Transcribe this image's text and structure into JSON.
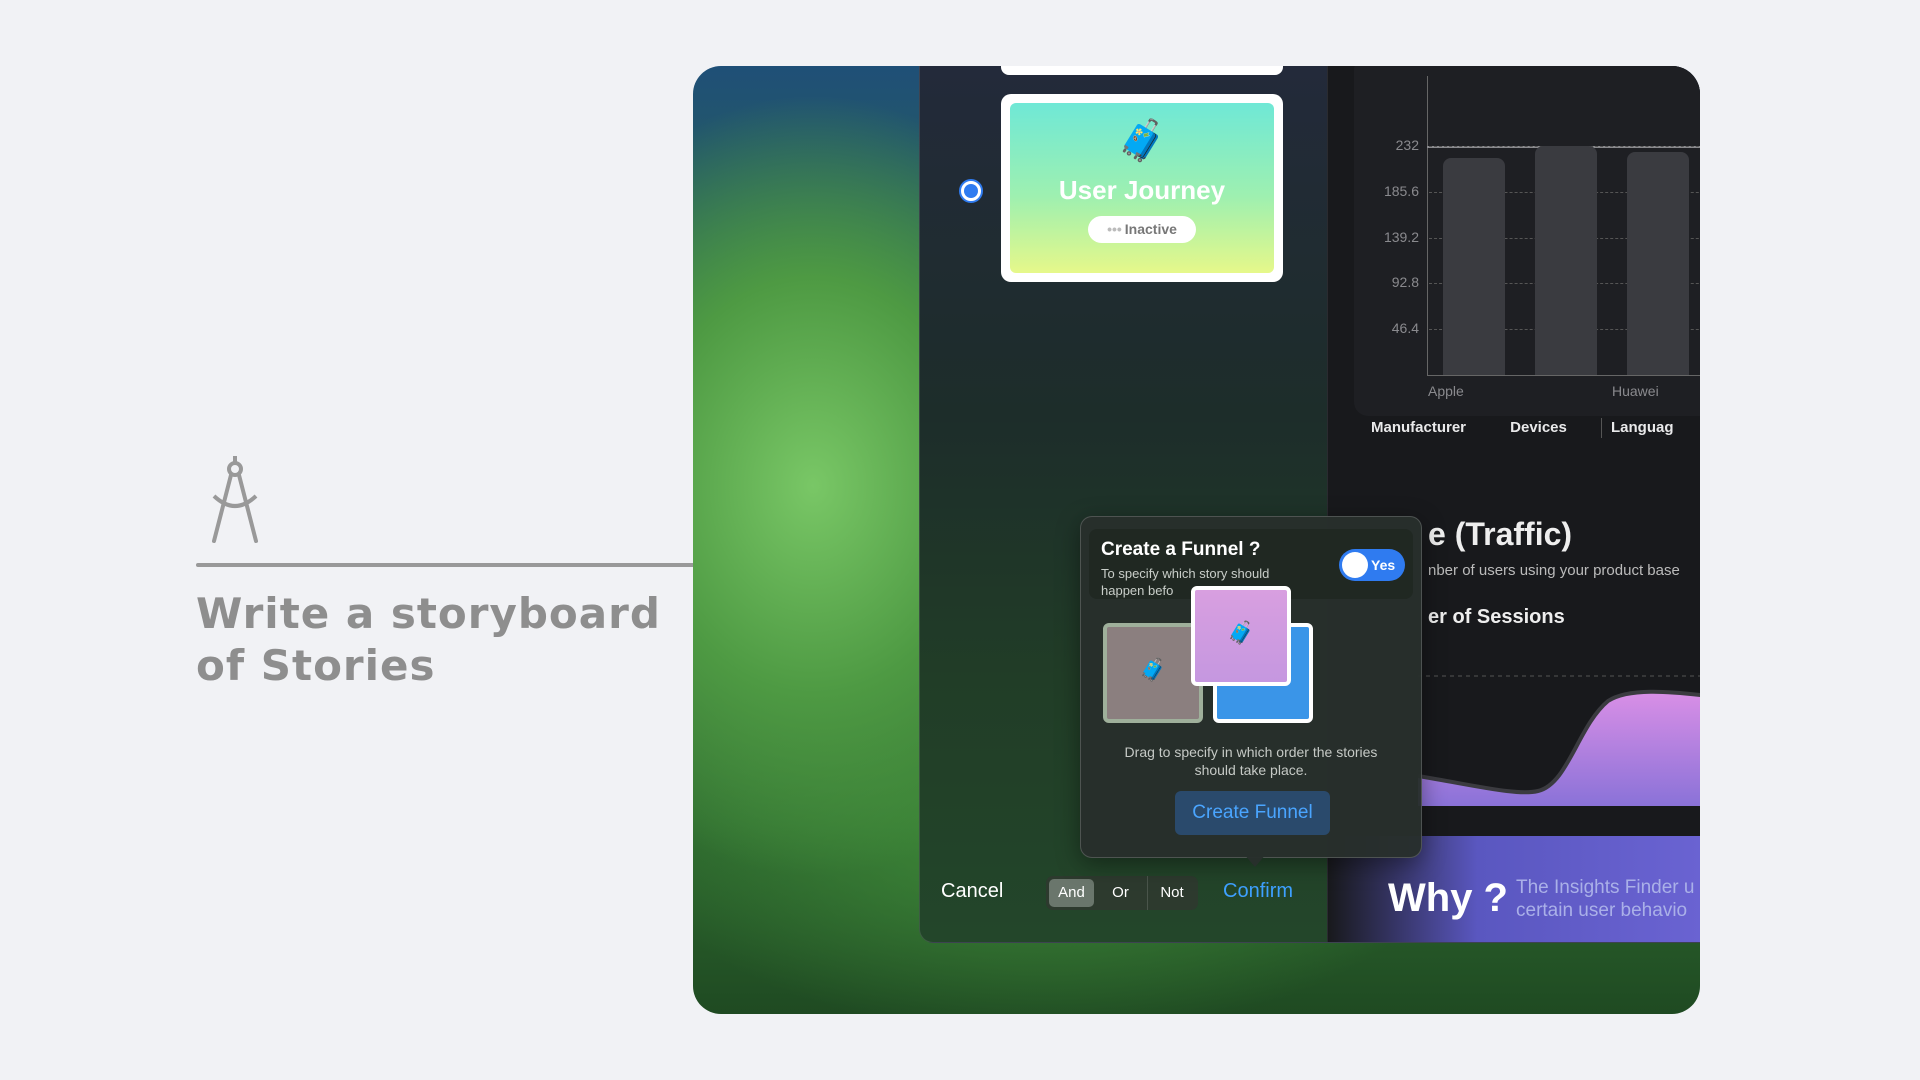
{
  "caption": {
    "line1": "Write a storyboard",
    "line2": "of Stories",
    "icon": "compass-drafting-icon"
  },
  "story_card": {
    "emoji": "🧳",
    "title": "User Journey",
    "status": "Inactive",
    "status_dots": "•••"
  },
  "chart_data": {
    "type": "bar",
    "categories": [
      "Apple",
      "",
      "Huawei"
    ],
    "values": [
      220,
      232,
      226
    ],
    "yticks": [
      "232",
      "185.6",
      "139.2",
      "92.8",
      "46.4"
    ],
    "ylim": [
      0,
      232
    ],
    "x_labels_visible": [
      "Apple",
      "Huawei"
    ],
    "grid": true
  },
  "segments": {
    "items": [
      "Manufacturer",
      "Devices",
      "Languag"
    ],
    "active": "Manufacturer"
  },
  "traffic": {
    "title": "e (Traffic)",
    "subtitle": "nber of users using your product base",
    "sessions": "er of Sessions"
  },
  "why": {
    "title": "Why ?",
    "text_line1": "The Insights Finder u",
    "text_line2": "certain user behavio"
  },
  "popover": {
    "title": "Create a Funnel ?",
    "subtitle_line1": "To specify which story should",
    "subtitle_line2": "happen befo",
    "toggle_label": "Yes",
    "hint_line1": "Drag to specify in which order the stories",
    "hint_line2": "should take place.",
    "button": "Create Funnel",
    "tile_emoji": "🧳"
  },
  "bottom_bar": {
    "cancel": "Cancel",
    "logic": [
      "And",
      "Or",
      "Not"
    ],
    "logic_active": "And",
    "confirm": "Confirm"
  },
  "colors": {
    "accent": "#2f7bf0",
    "confirm": "#3ea0ff",
    "background": "#f1f2f5"
  }
}
